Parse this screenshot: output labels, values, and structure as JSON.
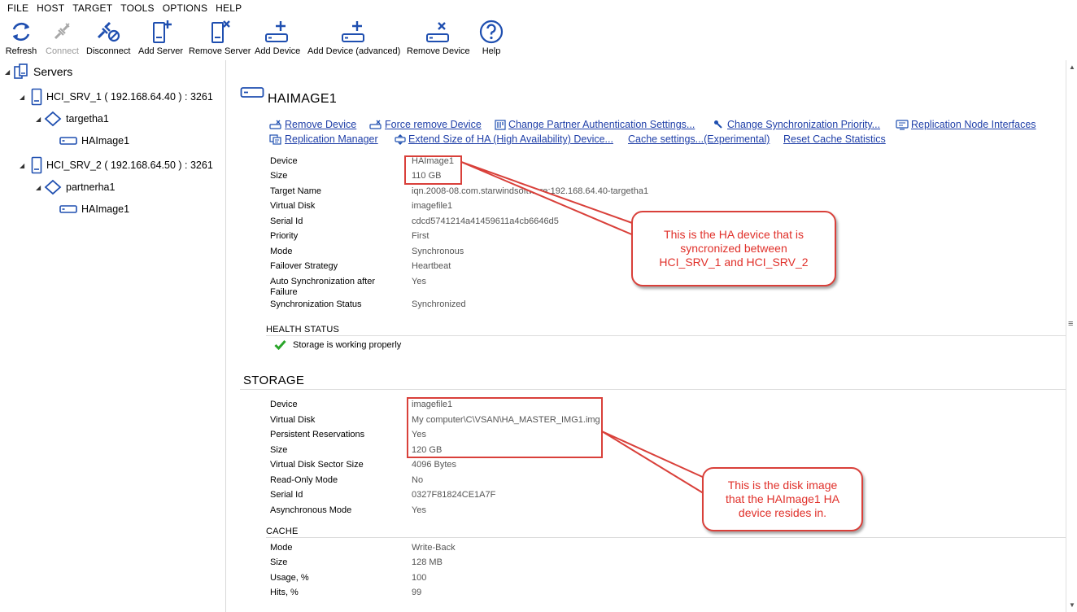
{
  "menu": [
    "FILE",
    "HOST",
    "TARGET",
    "TOOLS",
    "OPTIONS",
    "HELP"
  ],
  "toolbar": {
    "refresh": "Refresh",
    "connect": "Connect",
    "disconnect": "Disconnect",
    "add_server": "Add Server",
    "remove_server": "Remove Server",
    "add_device": "Add Device",
    "add_device_advanced": "Add Device (advanced)",
    "remove_device": "Remove Device",
    "help": "Help"
  },
  "tree": {
    "root": "Servers",
    "server1": "HCI_SRV_1 ( 192.168.64.40 ) : 3261",
    "target1": "targetha1",
    "device1": "HAImage1",
    "server2": "HCI_SRV_2 ( 192.168.64.50 ) : 3261",
    "target2": "partnerha1",
    "device2": "HAImage1"
  },
  "device": {
    "title": "HAIMAGE1",
    "actions": {
      "remove_device": "Remove Device",
      "force_remove": "Force remove Device",
      "change_partner_auth": "Change Partner Authentication Settings...",
      "change_sync_priority": "Change Synchronization Priority...",
      "replication_node_interfaces": "Replication Node Interfaces",
      "replication_manager": "Replication Manager",
      "extend_size": "Extend Size of HA (High Availability) Device...",
      "cache_settings": "Cache settings...(Experimental)",
      "reset_cache": "Reset Cache Statistics"
    },
    "props": [
      {
        "key": "Device",
        "value": "HAImage1"
      },
      {
        "key": "Size",
        "value": "110 GB"
      },
      {
        "key": "Target Name",
        "value": "iqn.2008-08.com.starwindsoftware:192.168.64.40-targetha1"
      },
      {
        "key": "Virtual Disk",
        "value": "imagefile1"
      },
      {
        "key": "Serial Id",
        "value": "cdcd5741214a41459611a4cb6646d5"
      },
      {
        "key": "Priority",
        "value": "First"
      },
      {
        "key": "Mode",
        "value": "Synchronous"
      },
      {
        "key": "Failover Strategy",
        "value": "Heartbeat"
      },
      {
        "key": "Auto Synchronization after Failure",
        "value": "Yes"
      },
      {
        "key": "Synchronization Status",
        "value": "Synchronized"
      }
    ],
    "health_heading": "HEALTH STATUS",
    "health_text": "Storage is working properly"
  },
  "storage": {
    "heading": "STORAGE",
    "props": [
      {
        "key": "Device",
        "value": "imagefile1"
      },
      {
        "key": "Virtual Disk",
        "value": "My computer\\C\\VSAN\\HA_MASTER_IMG1.img"
      },
      {
        "key": "Persistent Reservations",
        "value": "Yes"
      },
      {
        "key": "Size",
        "value": "120 GB"
      },
      {
        "key": "Virtual Disk Sector Size",
        "value": "4096 Bytes"
      },
      {
        "key": "Read-Only Mode",
        "value": "No"
      },
      {
        "key": "Serial Id",
        "value": "0327F81824CE1A7F"
      },
      {
        "key": "Asynchronous Mode",
        "value": "Yes"
      }
    ]
  },
  "cache": {
    "heading": "CACHE",
    "props": [
      {
        "key": "Mode",
        "value": "Write-Back"
      },
      {
        "key": "Size",
        "value": "128 MB"
      },
      {
        "key": "Usage, %",
        "value": "100"
      },
      {
        "key": "Hits, %",
        "value": "99"
      }
    ]
  },
  "callouts": {
    "ha_lines": [
      "This is the HA device that is",
      "syncronized between",
      "HCI_SRV_1 and HCI_SRV_2"
    ],
    "disk_lines": [
      "This is the disk image",
      "that the HAImage1 HA",
      "device resides in."
    ]
  },
  "colors": {
    "accent_blue": "#1f4fb0",
    "link": "#1f3fa8",
    "annotation_red": "#d9403a",
    "health_green": "#2aa52a"
  }
}
